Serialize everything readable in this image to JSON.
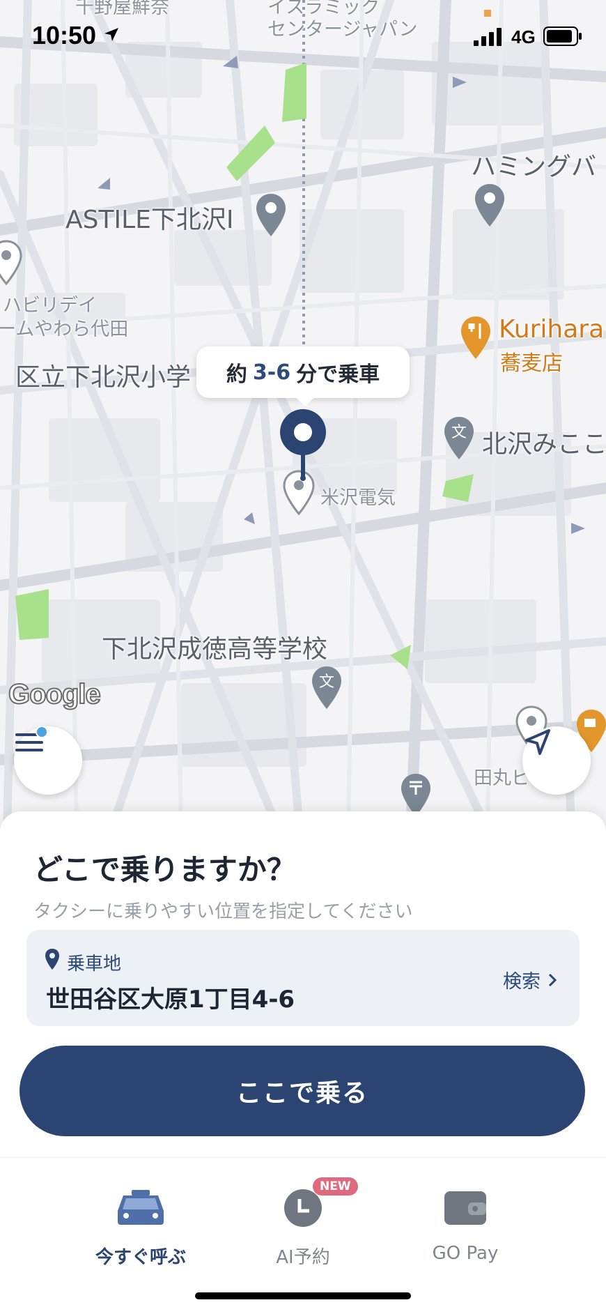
{
  "status_bar": {
    "time": "10:50",
    "network": "4G"
  },
  "map": {
    "eta_prefix": "約",
    "eta_range": "3-6",
    "eta_suffix": "分で乗車",
    "pois": {
      "astile": "ASTILE下北沢I",
      "humming": "ハミングバ",
      "habiri_1": "ハビリデイ",
      "habiri_2": "ームやわら代田",
      "kurihara_1": "Kurihara",
      "kurihara_2": "蕎麦店",
      "school_elem": "区立下北沢小学",
      "kitazawa": "北沢みここ",
      "yonezawa": "米沢電気",
      "seitoku": "下北沢成徳高等学校",
      "tamaru": "田丸ビ",
      "top_left": "千野屋鮮奈",
      "top_center_1": "イスラミック",
      "top_center_2": "センタージャパン"
    },
    "attribution": "Google",
    "colors": {
      "pin": "#2c4472",
      "park": "#a8e08c",
      "restaurant": "#e3962b"
    }
  },
  "sheet": {
    "title": "どこで乗りますか？",
    "subtitle": "タクシーに乗りやすい位置を指定してください",
    "pickup_label": "乗車地",
    "pickup_address": "世田谷区大原1丁目4-6",
    "search_label": "検索",
    "confirm_label": "ここで乗る"
  },
  "tabs": [
    {
      "label": "今すぐ呼ぶ",
      "icon": "taxi-icon",
      "active": true
    },
    {
      "label": "AI予約",
      "icon": "clock-icon",
      "badge": "NEW"
    },
    {
      "label": "GO Pay",
      "icon": "wallet-icon"
    }
  ]
}
